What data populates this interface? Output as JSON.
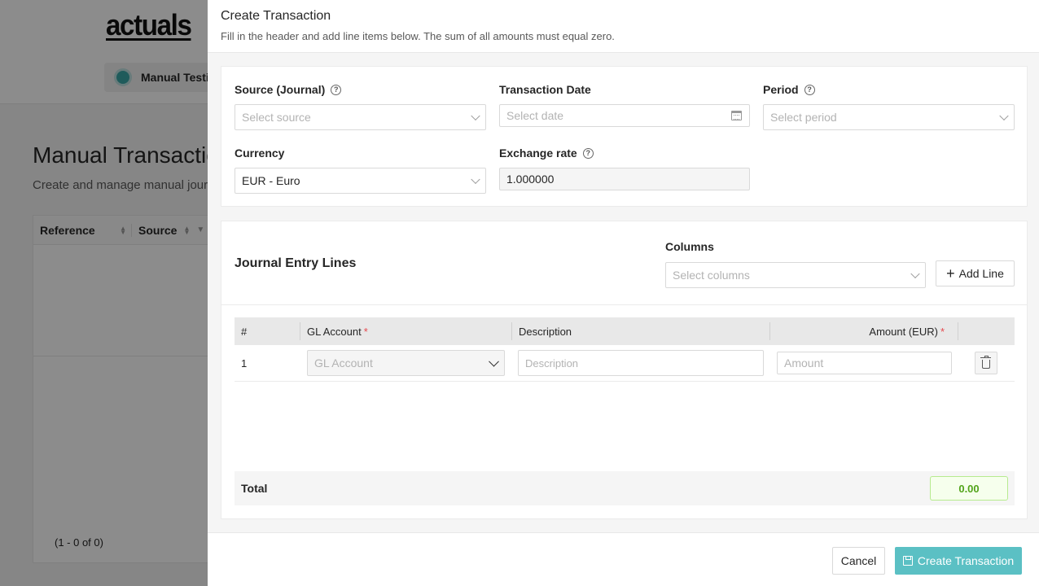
{
  "background": {
    "logo": "actuals",
    "org_name": "Manual Testi",
    "page_title": "Manual Transactio",
    "page_subtitle": "Create and manage manual journ",
    "table_headers": [
      "Reference",
      "Source"
    ],
    "pagination": "(1 - 0 of 0)"
  },
  "drawer": {
    "title": "Create Transaction",
    "description": "Fill in the header and add line items below. The sum of all amounts must equal zero."
  },
  "header_form": {
    "source_label": "Source (Journal)",
    "source_placeholder": "Select source",
    "date_label": "Transaction Date",
    "date_placeholder": "Select date",
    "period_label": "Period",
    "period_placeholder": "Select period",
    "currency_label": "Currency",
    "currency_value": "EUR - Euro",
    "exchange_label": "Exchange rate",
    "exchange_value": "1.000000",
    "help_glyph": "?"
  },
  "lines": {
    "title": "Journal Entry Lines",
    "columns_label": "Columns",
    "columns_placeholder": "Select columns",
    "add_line_label": "Add Line",
    "headers": {
      "index": "#",
      "gl_account": "GL Account",
      "description": "Description",
      "amount": "Amount (EUR)",
      "required_mark": "*"
    },
    "rows": [
      {
        "index": "1",
        "gl_account_placeholder": "GL Account",
        "description_placeholder": "Description",
        "amount_placeholder": "Amount"
      }
    ],
    "total_label": "Total",
    "total_value": "0.00"
  },
  "footer": {
    "cancel_label": "Cancel",
    "create_label": "Create Transaction"
  },
  "colors": {
    "primary": "#5bc0c4",
    "total_ok_bg": "#f6ffed",
    "total_ok_text": "#52a41a",
    "required": "#e5484d"
  },
  "icons": [
    "help-icon",
    "chevron-down-icon",
    "calendar-icon",
    "plus-icon",
    "trash-icon",
    "save-icon",
    "sort-icon",
    "filter-icon"
  ]
}
